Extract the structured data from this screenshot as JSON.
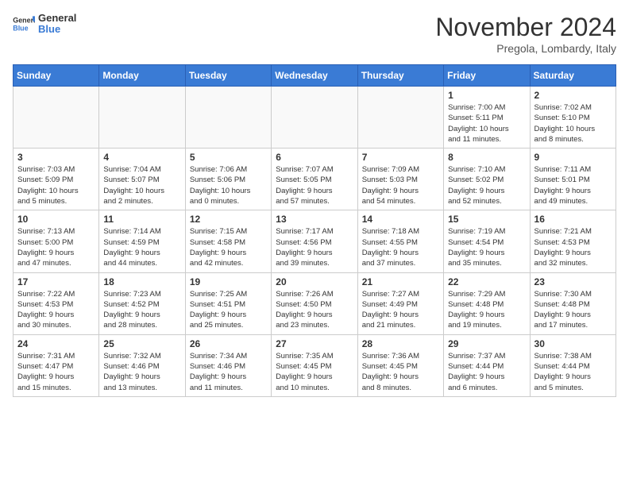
{
  "header": {
    "logo_general": "General",
    "logo_blue": "Blue",
    "month": "November 2024",
    "location": "Pregola, Lombardy, Italy"
  },
  "weekdays": [
    "Sunday",
    "Monday",
    "Tuesday",
    "Wednesday",
    "Thursday",
    "Friday",
    "Saturday"
  ],
  "weeks": [
    [
      {
        "day": "",
        "info": ""
      },
      {
        "day": "",
        "info": ""
      },
      {
        "day": "",
        "info": ""
      },
      {
        "day": "",
        "info": ""
      },
      {
        "day": "",
        "info": ""
      },
      {
        "day": "1",
        "info": "Sunrise: 7:00 AM\nSunset: 5:11 PM\nDaylight: 10 hours\nand 11 minutes."
      },
      {
        "day": "2",
        "info": "Sunrise: 7:02 AM\nSunset: 5:10 PM\nDaylight: 10 hours\nand 8 minutes."
      }
    ],
    [
      {
        "day": "3",
        "info": "Sunrise: 7:03 AM\nSunset: 5:09 PM\nDaylight: 10 hours\nand 5 minutes."
      },
      {
        "day": "4",
        "info": "Sunrise: 7:04 AM\nSunset: 5:07 PM\nDaylight: 10 hours\nand 2 minutes."
      },
      {
        "day": "5",
        "info": "Sunrise: 7:06 AM\nSunset: 5:06 PM\nDaylight: 10 hours\nand 0 minutes."
      },
      {
        "day": "6",
        "info": "Sunrise: 7:07 AM\nSunset: 5:05 PM\nDaylight: 9 hours\nand 57 minutes."
      },
      {
        "day": "7",
        "info": "Sunrise: 7:09 AM\nSunset: 5:03 PM\nDaylight: 9 hours\nand 54 minutes."
      },
      {
        "day": "8",
        "info": "Sunrise: 7:10 AM\nSunset: 5:02 PM\nDaylight: 9 hours\nand 52 minutes."
      },
      {
        "day": "9",
        "info": "Sunrise: 7:11 AM\nSunset: 5:01 PM\nDaylight: 9 hours\nand 49 minutes."
      }
    ],
    [
      {
        "day": "10",
        "info": "Sunrise: 7:13 AM\nSunset: 5:00 PM\nDaylight: 9 hours\nand 47 minutes."
      },
      {
        "day": "11",
        "info": "Sunrise: 7:14 AM\nSunset: 4:59 PM\nDaylight: 9 hours\nand 44 minutes."
      },
      {
        "day": "12",
        "info": "Sunrise: 7:15 AM\nSunset: 4:58 PM\nDaylight: 9 hours\nand 42 minutes."
      },
      {
        "day": "13",
        "info": "Sunrise: 7:17 AM\nSunset: 4:56 PM\nDaylight: 9 hours\nand 39 minutes."
      },
      {
        "day": "14",
        "info": "Sunrise: 7:18 AM\nSunset: 4:55 PM\nDaylight: 9 hours\nand 37 minutes."
      },
      {
        "day": "15",
        "info": "Sunrise: 7:19 AM\nSunset: 4:54 PM\nDaylight: 9 hours\nand 35 minutes."
      },
      {
        "day": "16",
        "info": "Sunrise: 7:21 AM\nSunset: 4:53 PM\nDaylight: 9 hours\nand 32 minutes."
      }
    ],
    [
      {
        "day": "17",
        "info": "Sunrise: 7:22 AM\nSunset: 4:53 PM\nDaylight: 9 hours\nand 30 minutes."
      },
      {
        "day": "18",
        "info": "Sunrise: 7:23 AM\nSunset: 4:52 PM\nDaylight: 9 hours\nand 28 minutes."
      },
      {
        "day": "19",
        "info": "Sunrise: 7:25 AM\nSunset: 4:51 PM\nDaylight: 9 hours\nand 25 minutes."
      },
      {
        "day": "20",
        "info": "Sunrise: 7:26 AM\nSunset: 4:50 PM\nDaylight: 9 hours\nand 23 minutes."
      },
      {
        "day": "21",
        "info": "Sunrise: 7:27 AM\nSunset: 4:49 PM\nDaylight: 9 hours\nand 21 minutes."
      },
      {
        "day": "22",
        "info": "Sunrise: 7:29 AM\nSunset: 4:48 PM\nDaylight: 9 hours\nand 19 minutes."
      },
      {
        "day": "23",
        "info": "Sunrise: 7:30 AM\nSunset: 4:48 PM\nDaylight: 9 hours\nand 17 minutes."
      }
    ],
    [
      {
        "day": "24",
        "info": "Sunrise: 7:31 AM\nSunset: 4:47 PM\nDaylight: 9 hours\nand 15 minutes."
      },
      {
        "day": "25",
        "info": "Sunrise: 7:32 AM\nSunset: 4:46 PM\nDaylight: 9 hours\nand 13 minutes."
      },
      {
        "day": "26",
        "info": "Sunrise: 7:34 AM\nSunset: 4:46 PM\nDaylight: 9 hours\nand 11 minutes."
      },
      {
        "day": "27",
        "info": "Sunrise: 7:35 AM\nSunset: 4:45 PM\nDaylight: 9 hours\nand 10 minutes."
      },
      {
        "day": "28",
        "info": "Sunrise: 7:36 AM\nSunset: 4:45 PM\nDaylight: 9 hours\nand 8 minutes."
      },
      {
        "day": "29",
        "info": "Sunrise: 7:37 AM\nSunset: 4:44 PM\nDaylight: 9 hours\nand 6 minutes."
      },
      {
        "day": "30",
        "info": "Sunrise: 7:38 AM\nSunset: 4:44 PM\nDaylight: 9 hours\nand 5 minutes."
      }
    ]
  ]
}
